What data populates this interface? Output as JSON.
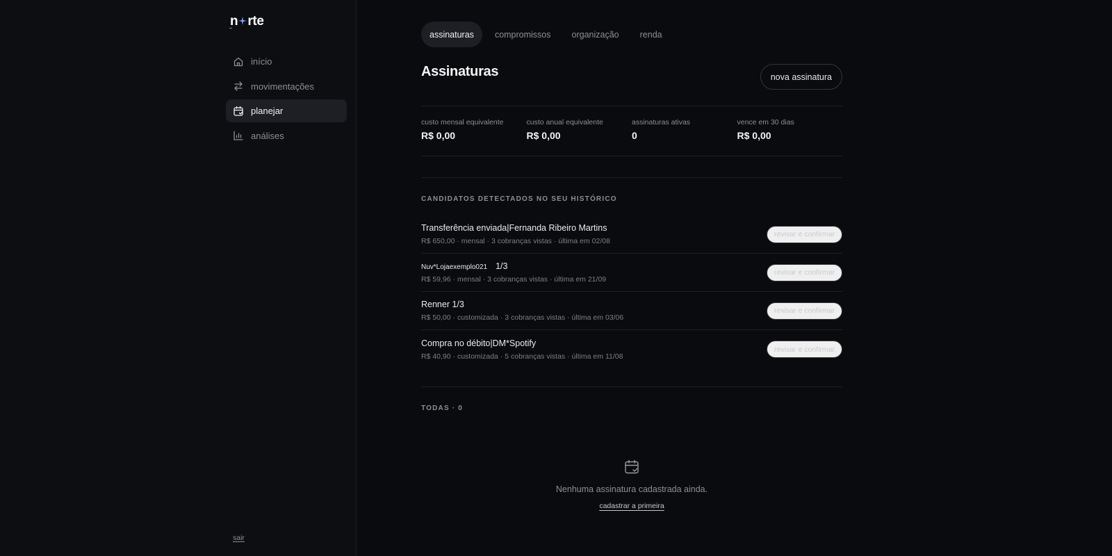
{
  "brand": {
    "name_left": "n",
    "name_right": "rte"
  },
  "sidebar": {
    "items": [
      {
        "label": "início",
        "icon": "home-icon"
      },
      {
        "label": "movimentações",
        "icon": "arrows-swap-icon"
      },
      {
        "label": "planejar",
        "icon": "calendar-icon",
        "active": true
      },
      {
        "label": "análises",
        "icon": "bar-chart-icon"
      }
    ],
    "signout_label": "sair"
  },
  "tabs": [
    "assinaturas",
    "compromissos",
    "organização",
    "renda"
  ],
  "active_tab": "assinaturas",
  "page": {
    "title": "Assinaturas",
    "new_button": "nova assinatura"
  },
  "stats": [
    {
      "label": "custo mensal equivalente",
      "value": "R$ 0,00"
    },
    {
      "label": "custo anual equivalente",
      "value": "R$ 0,00"
    },
    {
      "label": "assinaturas ativas",
      "value": "0"
    },
    {
      "label": "vence em 30 dias",
      "value": "R$ 0,00"
    }
  ],
  "candidates": {
    "title": "CANDIDATOS DETECTADOS NO SEU HISTÓRICO",
    "review_label": "revisar e confirmar",
    "items": [
      {
        "name": "Transferência enviada|Fernanda Ribeiro Martins",
        "meta": "R$ 650,00 · mensal · 3 cobranças vistas · última em 02/08"
      },
      {
        "name_small": "Nuv*Lojaexemplo021",
        "name_suffix": "1/3",
        "meta": "R$ 59,96 · mensal · 3 cobranças vistas · última em 21/09"
      },
      {
        "name": "Renner 1/3",
        "meta": "R$ 50,00 · customizada · 3 cobranças vistas · última em 03/06"
      },
      {
        "name": "Compra no débito|DM*Spotify",
        "meta": "R$ 40,90 · customizada · 5 cobranças vistas · última em 11/08"
      }
    ]
  },
  "all": {
    "title": "TODAS · 0",
    "empty_text": "Nenhuma assinatura cadastrada ainda.",
    "empty_link": "cadastrar a primeira"
  },
  "colors": {
    "background": "#0a0b0e",
    "sidebar": "#0d0e11",
    "active": "#1e1f24",
    "text_muted": "#8e8f96"
  }
}
